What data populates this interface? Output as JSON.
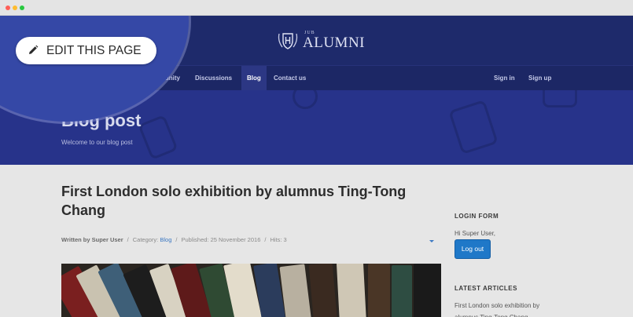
{
  "logo": {
    "small": "JUB",
    "big": "ALUMNI"
  },
  "nav": {
    "items": [
      {
        "label": "Community"
      },
      {
        "label": "Discussions"
      },
      {
        "label": "Blog"
      },
      {
        "label": "Contact us"
      }
    ],
    "sign_in": "Sign in",
    "sign_up": "Sign up"
  },
  "hero": {
    "title": "Blog post",
    "subtitle": "Welcome to our blog post"
  },
  "article": {
    "title": "First London solo exhibition by alumnus Ting-Tong Chang",
    "meta": {
      "author": "Written by Super User",
      "category_label": "Category:",
      "category_value": "Blog",
      "published": "Published: 25 November 2016",
      "hits": "Hits: 3",
      "separator": "/"
    }
  },
  "sidebar": {
    "login_heading": "LOGIN FORM",
    "greeting": "Hi Super User,",
    "logout_label": "Log out",
    "latest_heading": "LATEST ARTICLES",
    "latest_item": "First London solo exhibition by alumnus Ting-Tong Chang"
  },
  "overlay": {
    "edit_label": "EDIT THIS PAGE",
    "icon": "pencil-icon"
  },
  "colors": {
    "header": "#1e2a6b",
    "hero": "#27338a",
    "accent": "#1f78c8",
    "spotlight": "#3548a6"
  }
}
